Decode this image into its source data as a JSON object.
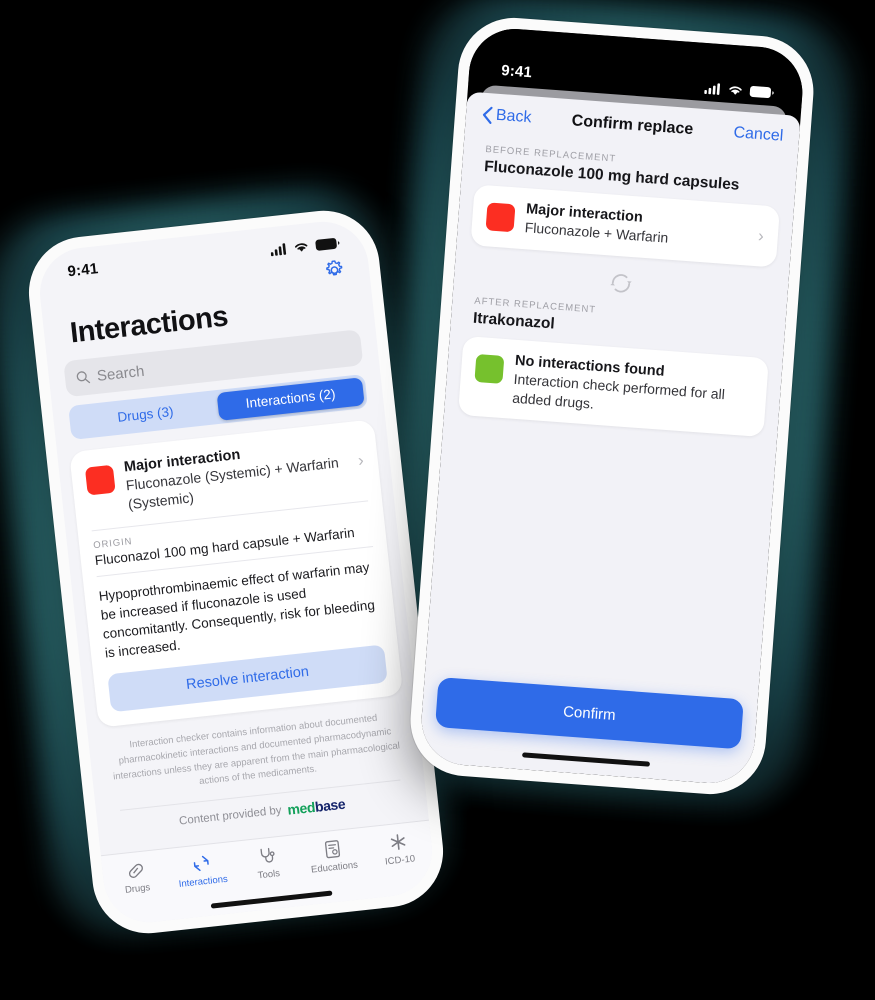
{
  "background_color": "#000000",
  "accent_blue": "#2F6BE8",
  "severity_red": "#FC2E22",
  "severity_green": "#76C12D",
  "left_phone": {
    "status_bar": {
      "time": "9:41",
      "cellular_icon": "signal-bars-icon",
      "wifi_icon": "wifi-icon",
      "battery_icon": "battery-icon"
    },
    "gear_icon": "gear-icon",
    "page_title": "Interactions",
    "search": {
      "placeholder": "Search",
      "icon": "search-icon"
    },
    "segmented": {
      "options": [
        {
          "label": "Drugs (3)",
          "active": false
        },
        {
          "label": "Interactions (2)",
          "active": true
        }
      ]
    },
    "interaction_card": {
      "severity_label": "Major interaction",
      "severity_color": "#FC2E22",
      "drugs": "Fluconazole (Systemic) + Warfarin (Systemic)",
      "chevron_icon": "chevron-right-icon",
      "origin_label": "ORIGIN",
      "origin_value": "Fluconazol 100 mg hard capsule + Warfarin",
      "description": "Hypoprothrombinaemic effect of warfarin may be increased if fluconazole is used concomitantly. Consequently, risk for bleeding is increased.",
      "resolve_button": "Resolve interaction"
    },
    "disclaimer": "Interaction checker contains information about documented pharmacokinetic interactions and documented pharmacodynamic interactions unless they are apparent from the main pharmacological actions of the medicaments.",
    "provided_by": "Content provided by",
    "logo": {
      "part1": "med",
      "part2": "base"
    },
    "tabs": [
      {
        "label": "Drugs",
        "icon": "pill-icon",
        "active": false
      },
      {
        "label": "Interactions",
        "icon": "interactions-arrows-icon",
        "active": true
      },
      {
        "label": "Tools",
        "icon": "stethoscope-icon",
        "active": false
      },
      {
        "label": "Educations",
        "icon": "certificate-icon",
        "active": false
      },
      {
        "label": "ICD-10",
        "icon": "asterisk-icon",
        "active": false
      }
    ]
  },
  "right_phone": {
    "status_bar": {
      "time": "9:41",
      "cellular_icon": "signal-bars-icon",
      "wifi_icon": "wifi-icon",
      "battery_icon": "battery-icon"
    },
    "nav": {
      "back": "Back",
      "back_icon": "chevron-left-icon",
      "title": "Confirm replace",
      "cancel": "Cancel"
    },
    "before": {
      "section_label": "BEFORE REPLACEMENT",
      "drug": "Fluconazole 100 mg hard capsules",
      "card": {
        "title": "Major interaction",
        "subtitle": "Fluconazole + Warfarin",
        "severity_color": "#FC2E22",
        "chevron_icon": "chevron-right-icon"
      }
    },
    "swap_icon": "refresh-swap-icon",
    "after": {
      "section_label": "AFTER REPLACEMENT",
      "drug": "Itrakonazol",
      "card": {
        "title": "No interactions found",
        "subtitle": "Interaction check performed for all added drugs.",
        "severity_color": "#76C12D"
      }
    },
    "confirm_button": "Confirm"
  }
}
